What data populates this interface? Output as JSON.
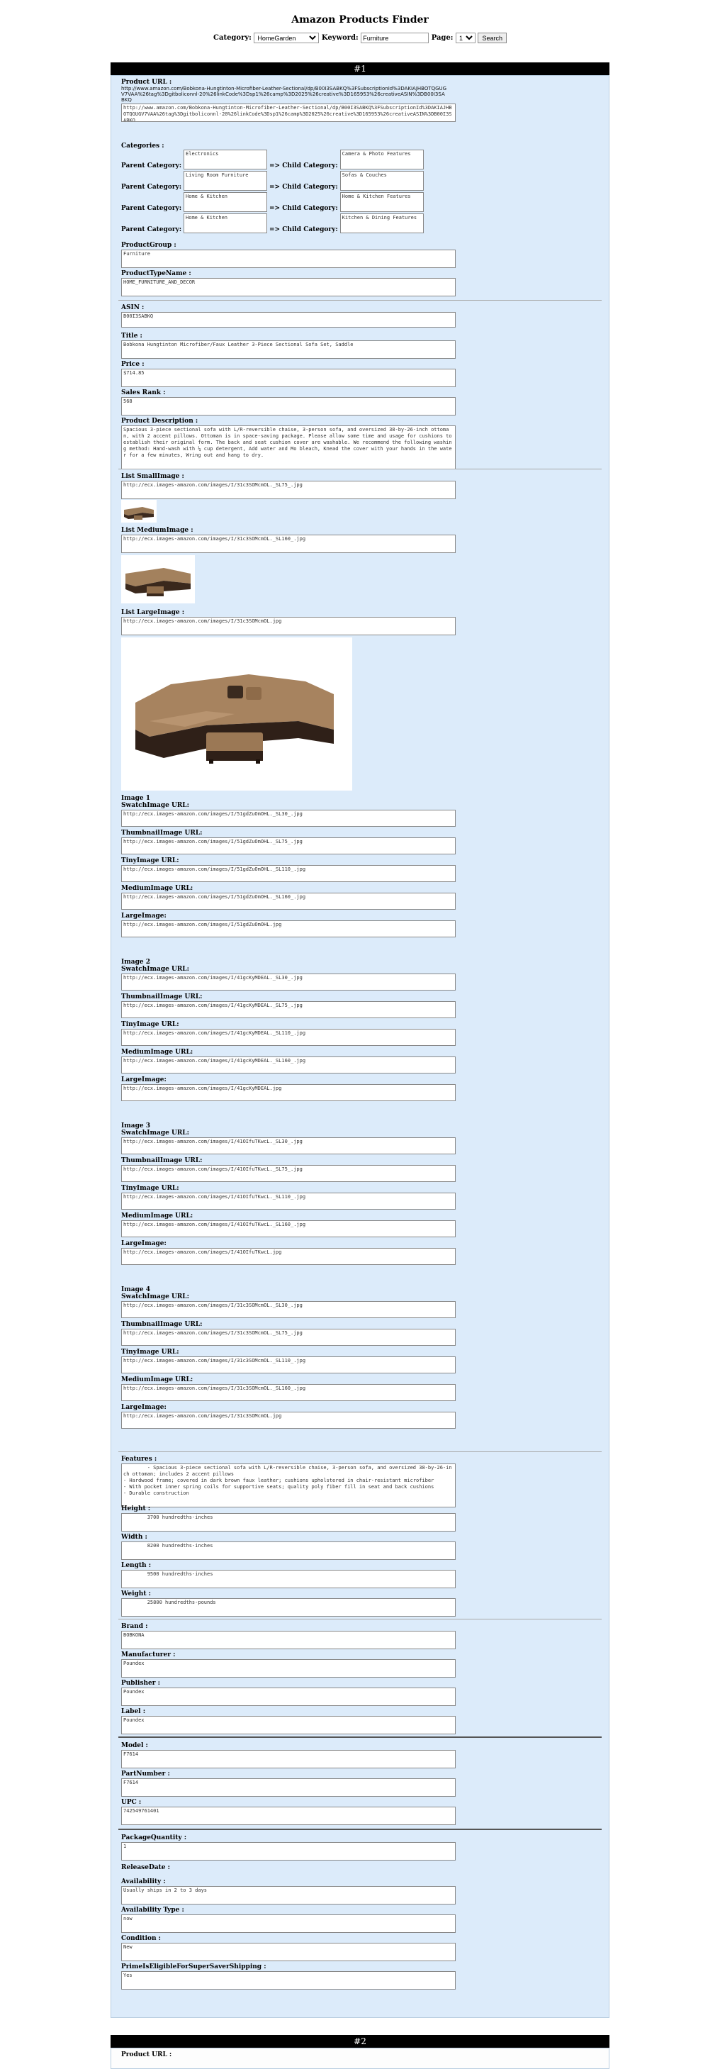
{
  "header": {
    "title": "Amazon Products Finder",
    "category_label": "Category:",
    "category_value": "HomeGarden",
    "keyword_label": "Keyword:",
    "keyword_value": "Furniture",
    "page_label": "Page:",
    "page_value": "1",
    "search_label": "Search"
  },
  "record1": {
    "number": "#1",
    "product_url_label": "Product URL :",
    "product_url_text": "http://www.amazon.com/Bobkona-Hungtinton-Microfiber-Leather-Sectional/dp/B00I3SABKQ%3FSubscriptionId%3DAKIAJHBOTQGUGV7VAA%26tag%3Dgitboliconnl-20%26linkCode%3Dsp1%26camp%3D2025%26creative%3D165953%26creativeASIN%3DB00I3SABKQ",
    "product_url_box": "http://www.amazon.com/Bobkona-Hungtinton-Microfiber-Leather-Sectional/dp/B00I3SABKQ%3FSubscriptionId%3DAKIAJHBOTQGUGV7VAA%26tag%3Dgitboliconnl-20%26linkCode%3Dsp1%26camp%3D2025%26creative%3D165953%26creativeASIN%3DB00I3SABKQ",
    "categories_label": "Categories :",
    "parent_label": "Parent Category:",
    "arrow_label": "=> Child Category:",
    "categories": [
      {
        "parent": "Electronics",
        "child": "Camera & Photo Features"
      },
      {
        "parent": "Living Room Furniture",
        "child": "Sofas & Couches"
      },
      {
        "parent": "Home & Kitchen",
        "child": "Home & Kitchen Features"
      },
      {
        "parent": "Home & Kitchen",
        "child": "Kitchen & Dining Features"
      }
    ],
    "product_group_label": "ProductGroup :",
    "product_group": "Furniture",
    "product_type_label": "ProductTypeName :",
    "product_type": "HOME_FURNITURE_AND_DECOR",
    "asin_label": "ASIN :",
    "asin": "B00I3SABKQ",
    "title_label": "Title :",
    "title": "Bobkona Hungtinton Microfiber/Faux Leather 3-Piece Sectional Sofa Set, Saddle",
    "price_label": "Price :",
    "price": "$714.85",
    "sales_rank_label": "Sales Rank :",
    "sales_rank": "568",
    "description_label": "Product Description :",
    "description": "Spacious 3-piece sectional sofa with L/R-reversible chaise, 3-person sofa, and oversized 38-by-26-inch ottoman, with 2 accent pillows. Ottoman is in space-saving package. Please allow some time and usage for cushions to establish their original form. The back and seat cushion cover are washable. We recommend the following washing method: Hand-wash with ¼ cup detergent, Add water and Mo bleach, Knead the cover with your hands in the water for a few minutes, Wring out and hang to dry.",
    "small_image_label": "List SmallImage :",
    "small_image": "http://ecx.images-amazon.com/images/I/31c3SOMcmOL._SL75_.jpg",
    "medium_image_label": "List MediumImage :",
    "medium_image": "http://ecx.images-amazon.com/images/I/31c3SOMcmOL._SL160_.jpg",
    "large_image_label": "List LargeImage :",
    "large_image": "http://ecx.images-amazon.com/images/I/31c3SOMcmOL.jpg",
    "swatch_label": "SwatchImage URL:",
    "thumbnail_label": "ThumbnailImage URL:",
    "tiny_label": "TinyImage URL:",
    "mediumimg_label": "MediumImage URL:",
    "largeimg_label": "LargeImage:",
    "image_sets": [
      {
        "title": "Image 1",
        "swatch": "http://ecx.images-amazon.com/images/I/51gdZuOmOHL._SL30_.jpg",
        "thumbnail": "http://ecx.images-amazon.com/images/I/51gdZuOmOHL._SL75_.jpg",
        "tiny": "http://ecx.images-amazon.com/images/I/51gdZuOmOHL._SL110_.jpg",
        "medium": "http://ecx.images-amazon.com/images/I/51gdZuOmOHL._SL160_.jpg",
        "large": "http://ecx.images-amazon.com/images/I/51gdZuOmOHL.jpg"
      },
      {
        "title": "Image 2",
        "swatch": "http://ecx.images-amazon.com/images/I/41gcKyMDEAL._SL30_.jpg",
        "thumbnail": "http://ecx.images-amazon.com/images/I/41gcKyMDEAL._SL75_.jpg",
        "tiny": "http://ecx.images-amazon.com/images/I/41gcKyMDEAL._SL110_.jpg",
        "medium": "http://ecx.images-amazon.com/images/I/41gcKyMDEAL._SL160_.jpg",
        "large": "http://ecx.images-amazon.com/images/I/41gcKyMDEAL.jpg"
      },
      {
        "title": "Image 3",
        "swatch": "http://ecx.images-amazon.com/images/I/41OIfuTKwcL._SL30_.jpg",
        "thumbnail": "http://ecx.images-amazon.com/images/I/41OIfuTKwcL._SL75_.jpg",
        "tiny": "http://ecx.images-amazon.com/images/I/41OIfuTKwcL._SL110_.jpg",
        "medium": "http://ecx.images-amazon.com/images/I/41OIfuTKwcL._SL160_.jpg",
        "large": "http://ecx.images-amazon.com/images/I/41OIfuTKwcL.jpg"
      },
      {
        "title": "Image 4",
        "swatch": "http://ecx.images-amazon.com/images/I/31c3SOMcmOL._SL30_.jpg",
        "thumbnail": "http://ecx.images-amazon.com/images/I/31c3SOMcmOL._SL75_.jpg",
        "tiny": "http://ecx.images-amazon.com/images/I/31c3SOMcmOL._SL110_.jpg",
        "medium": "http://ecx.images-amazon.com/images/I/31c3SOMcmOL._SL160_.jpg",
        "large": "http://ecx.images-amazon.com/images/I/31c3SOMcmOL.jpg"
      }
    ],
    "features_label": "Features :",
    "features": "        - Spacious 3-piece sectional sofa with L/R-reversible chaise, 3-person sofa, and oversized 38-by-26-inch ottoman; includes 2 accent pillows\n- Hardwood frame; covered in dark brown faux leather; cushions upholstered in chair-resistant microfiber\n- With pocket inner spring coils for supportive seats; quality poly fiber fill in seat and back cushions\n- Durable construction",
    "height_label": "Height :",
    "height": "        3700 hundredths-inches",
    "width_label": "Width :",
    "width": "        8200 hundredths-inches",
    "length_label": "Length :",
    "length": "        9500 hundredths-inches",
    "weight_label": "Weight :",
    "weight": "        25800 hundredths-pounds",
    "brand_label": "Brand :",
    "brand": "BOBKONA",
    "manufacturer_label": "Manufacturer :",
    "manufacturer": "Poundex",
    "publisher_label": "Publisher :",
    "publisher": "Poundex",
    "studio_label": "Label :",
    "studio": "Poundex",
    "model_label": "Model :",
    "model": "F7614",
    "part_label": "PartNumber :",
    "part": "F7614",
    "upc_label": "UPC :",
    "upc": "742549761401",
    "package_qty_label": "PackageQuantity :",
    "package_qty": "1",
    "release_label": "ReleaseDate :",
    "availability_label": "Availability :",
    "availability": "Usually ships in 2 to 3 days",
    "availability_type_label": "Availability Type :",
    "availability_type": "now",
    "condition_label": "Condition :",
    "condition": "New",
    "prime_label": "PrimeIsEligibleForSuperSaverShipping :",
    "prime": "Yes"
  },
  "record2": {
    "number": "#2",
    "product_url_label": "Product URL :"
  }
}
